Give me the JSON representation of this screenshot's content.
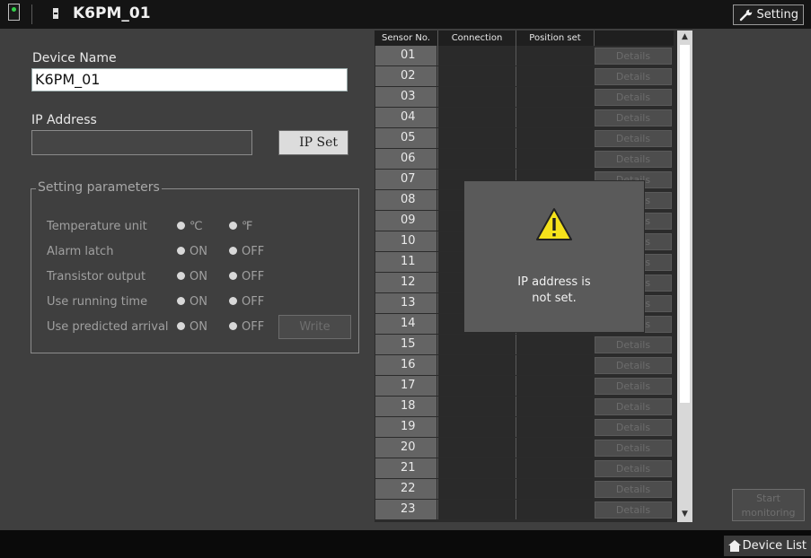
{
  "header": {
    "title": "K6PM_01",
    "setting_label": "Setting"
  },
  "device": {
    "name_label": "Device Name",
    "name_value": "K6PM_01",
    "ip_label": "IP Address",
    "ip_value": "",
    "ip_set_label": "IP Set"
  },
  "params": {
    "legend": "Setting parameters",
    "temp_label": "Temperature unit",
    "temp_opt1": "℃",
    "temp_opt2": "℉",
    "alarm_label": "Alarm latch",
    "transistor_label": "Transistor output",
    "running_label": "Use running time",
    "predicted_label": "Use predicted arrival",
    "on_label": "ON",
    "off_label": "OFF",
    "write_label": "Write"
  },
  "table": {
    "columns": [
      "Sensor No.",
      "Connection",
      "Position set",
      ""
    ],
    "details_label": "Details",
    "rows": [
      "01",
      "02",
      "03",
      "04",
      "05",
      "06",
      "07",
      "08",
      "09",
      "10",
      "11",
      "12",
      "13",
      "14",
      "15",
      "16",
      "17",
      "18",
      "19",
      "20",
      "21",
      "22",
      "23"
    ]
  },
  "dialog": {
    "message_line1": "IP address is",
    "message_line2": "not set."
  },
  "footer": {
    "start_line1": "Start",
    "start_line2": "monitoring",
    "device_list_label": "Device List"
  },
  "colors": {
    "background": "#3f3f3f",
    "titlebar": "#141414",
    "status_green": "#33d04a",
    "warning_yellow": "#f5e21b"
  }
}
